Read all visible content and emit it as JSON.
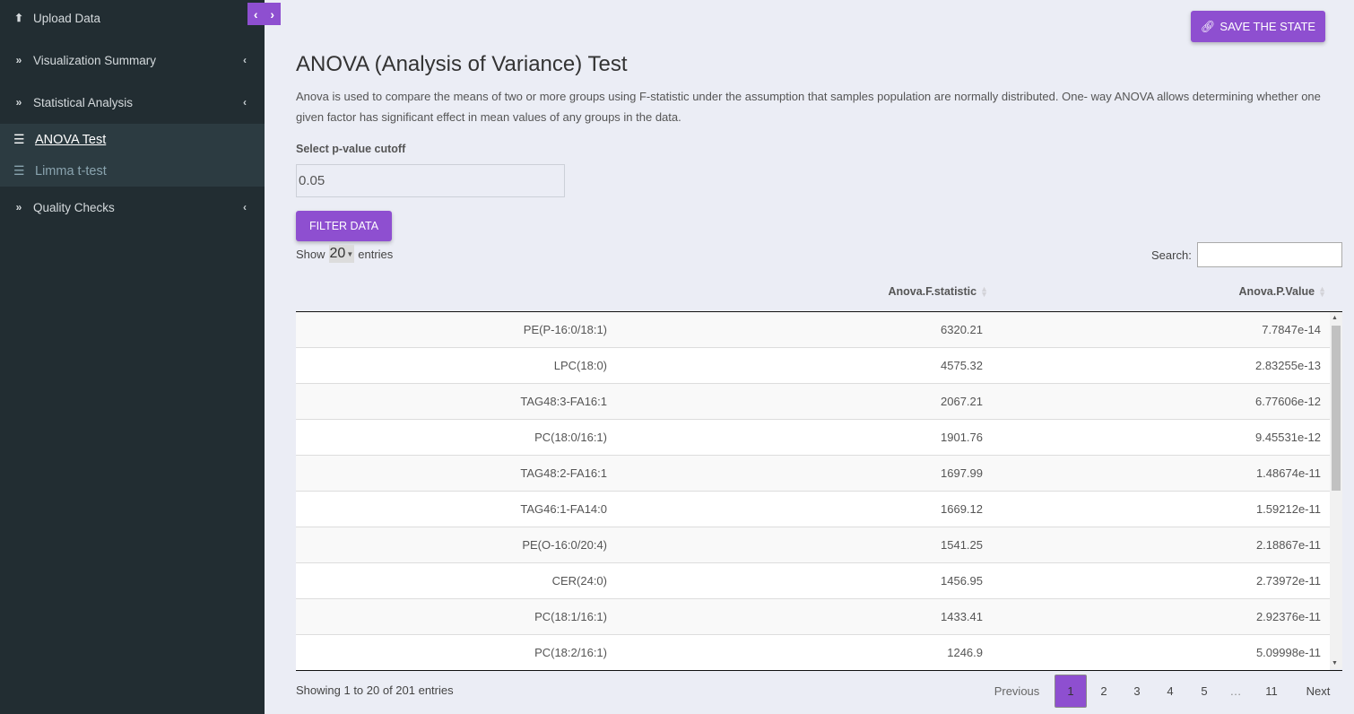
{
  "sidebar": {
    "toggle": {
      "left_icon": "‹",
      "right_icon": "›"
    },
    "items": [
      {
        "label": "Upload Data",
        "icon": "upload-icon"
      },
      {
        "label": "Visualization Summary",
        "icon": "double-chevron-right-icon"
      },
      {
        "label": "Statistical Analysis",
        "icon": "double-chevron-right-icon"
      },
      {
        "label": "Quality Checks",
        "icon": "double-chevron-right-icon"
      }
    ],
    "subitems": [
      {
        "label": " ANOVA Test",
        "icon": "list-check-icon",
        "active": true
      },
      {
        "label": "Limma t-test",
        "icon": "list-check-icon",
        "active": false
      }
    ]
  },
  "header": {
    "save_button": "SAVE THE STATE"
  },
  "main": {
    "title": "ANOVA (Analysis of Variance) Test",
    "description": "Anova is used to compare the means of two or more groups using F-statistic under the assumption that samples population are normally distributed. One- way ANOVA allows determining whether one given factor has significant effect in mean values of any groups in the data.",
    "cutoff_label": "Select p-value cutoff",
    "cutoff_value": "0.05",
    "filter_button": "FILTER DATA"
  },
  "table": {
    "show_label": "Show",
    "page_length": "20",
    "entries_label": "entries",
    "search_label": "Search:",
    "search_value": "",
    "columns": [
      "",
      "Anova.F.statistic",
      "Anova.P.Value"
    ],
    "rows": [
      [
        "PE(P-16:0/18:1)",
        "6320.21",
        "7.7847e-14"
      ],
      [
        "LPC(18:0)",
        "4575.32",
        "2.83255e-13"
      ],
      [
        "TAG48:3-FA16:1",
        "2067.21",
        "6.77606e-12"
      ],
      [
        "PC(18:0/16:1)",
        "1901.76",
        "9.45531e-12"
      ],
      [
        "TAG48:2-FA16:1",
        "1697.99",
        "1.48674e-11"
      ],
      [
        "TAG46:1-FA14:0",
        "1669.12",
        "1.59212e-11"
      ],
      [
        "PE(O-16:0/20:4)",
        "1541.25",
        "2.18867e-11"
      ],
      [
        "CER(24:0)",
        "1456.95",
        "2.73972e-11"
      ],
      [
        "PC(18:1/16:1)",
        "1433.41",
        "2.92376e-11"
      ],
      [
        "PC(18:2/16:1)",
        "1246.9",
        "5.09998e-11"
      ]
    ],
    "info": "Showing 1 to 20 of 201 entries",
    "pagination": {
      "previous": "Previous",
      "pages": [
        "1",
        "2",
        "3",
        "4",
        "5",
        "…",
        "11"
      ],
      "current": "1",
      "next": "Next"
    }
  },
  "colors": {
    "accent": "#8e4fd0",
    "sidebar_bg": "#222d32",
    "submenu_bg": "#2c3b41",
    "page_bg": "#ebedf5"
  }
}
